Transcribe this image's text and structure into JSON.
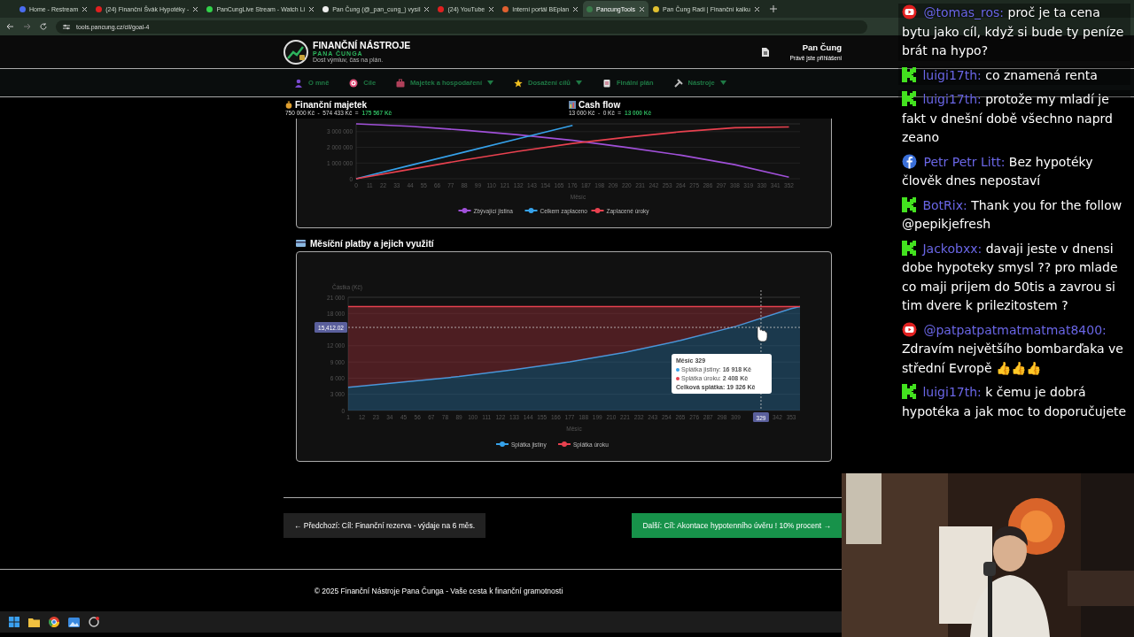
{
  "browser": {
    "tabs": [
      {
        "label": "Home - Restream",
        "selected": false
      },
      {
        "label": "(24) Finanční Švák Hypotéky -",
        "selected": false
      },
      {
        "label": "PanCungLive Stream - Watch Li",
        "selected": false
      },
      {
        "label": "Pan Čung (@_pan_cung_) vysíl",
        "selected": false
      },
      {
        "label": "(24) YouTube",
        "selected": false
      },
      {
        "label": "Interní portál BEplan",
        "selected": false
      },
      {
        "label": "PancungTools",
        "selected": true
      },
      {
        "label": "Pan Čung Radí | Finanční kalku",
        "selected": false
      }
    ],
    "address": "tools.pancung.cz/cil/goal-4"
  },
  "header": {
    "title": "FINANČNÍ NÁSTROJE",
    "subtitle": "PANA ČUNGA",
    "tagline": "Dost výmluv, čas na plán.",
    "user_name": "Pan Čung",
    "user_status": "Právě jste přihlášeni"
  },
  "nav": [
    {
      "label": "O mně",
      "has_dropdown": false
    },
    {
      "label": "Cíle",
      "has_dropdown": false
    },
    {
      "label": "Majetek a hospodaření",
      "has_dropdown": true
    },
    {
      "label": "Dosažení cílů",
      "has_dropdown": true
    },
    {
      "label": "Finální plán",
      "has_dropdown": false
    },
    {
      "label": "Nástroje",
      "has_dropdown": true
    }
  ],
  "summary": [
    {
      "title": "Finanční majetek",
      "formula": "750 000 Kč  -  574 433 Kč  =",
      "result": "175 567 Kč"
    },
    {
      "title": "Cash flow",
      "formula": "13 000 Kč  -  0 Kč  =",
      "result": "13 000 Kč"
    }
  ],
  "balance_chart": {
    "chart_data": {
      "type": "line",
      "xlabel": "Měsíc",
      "grid": true,
      "legend": "bottom",
      "x": [
        0,
        44,
        88,
        132,
        176,
        220,
        264,
        308,
        352
      ],
      "xlim": [
        0,
        361
      ],
      "ylim": [
        0,
        3500000
      ],
      "xticks": [
        0,
        11,
        22,
        33,
        44,
        55,
        66,
        77,
        88,
        99,
        110,
        121,
        132,
        143,
        154,
        165,
        176,
        187,
        198,
        209,
        220,
        231,
        242,
        253,
        264,
        275,
        286,
        297,
        308,
        319,
        330,
        341,
        352
      ],
      "yticks": [
        {
          "value": 0,
          "label": "0"
        },
        {
          "value": 1000000,
          "label": "1 000 000"
        },
        {
          "value": 2000000,
          "label": "2 000 000"
        },
        {
          "value": 3000000,
          "label": "3 000 000"
        }
      ],
      "series": [
        {
          "name": "Zbývající jistina",
          "color": "#a050d8",
          "values": [
            3500000,
            3350000,
            3100000,
            2800000,
            2450000,
            2000000,
            1500000,
            900000,
            100000
          ]
        },
        {
          "name": "Celkem zaplaceno",
          "color": "#36a2eb",
          "values": [
            0,
            850000,
            1700000,
            2550000,
            3400000,
            null,
            null,
            null,
            null
          ]
        },
        {
          "name": "Zaplacené úroky",
          "color": "#e8414f",
          "values": [
            0,
            600000,
            1200000,
            1750000,
            2250000,
            2650000,
            3000000,
            3250000,
            3300000
          ]
        }
      ]
    }
  },
  "payments_section": {
    "title": "Měsíční platby a jejich využití",
    "chart_data": {
      "type": "area",
      "stacked": true,
      "grid": true,
      "legend": "bottom",
      "ylabel": "Částka (Kč)",
      "xlabel": "Měsíc",
      "x": [
        1,
        45,
        89,
        133,
        177,
        221,
        265,
        309,
        353,
        360
      ],
      "xlim": [
        1,
        360
      ],
      "ylim": [
        0,
        21000
      ],
      "xticks": [
        1,
        12,
        23,
        34,
        45,
        56,
        67,
        78,
        89,
        100,
        111,
        122,
        133,
        144,
        155,
        166,
        177,
        188,
        199,
        210,
        221,
        232,
        243,
        254,
        265,
        276,
        287,
        298,
        309,
        342,
        353
      ],
      "yticks": [
        {
          "value": 0,
          "label": "0"
        },
        {
          "value": 3000,
          "label": "3 000"
        },
        {
          "value": 6000,
          "label": "6 000"
        },
        {
          "value": 9000,
          "label": "9 000"
        },
        {
          "value": 12000,
          "label": "12 000"
        },
        {
          "value": 18000,
          "label": "18 000"
        },
        {
          "value": 21000,
          "label": "21 000"
        }
      ],
      "series": [
        {
          "name": "Splátka jistiny",
          "color": "#36a2eb",
          "values": [
            4300,
            5300,
            6300,
            7600,
            9000,
            10800,
            13000,
            15600,
            18900,
            19300
          ]
        },
        {
          "name": "Splátka úroku",
          "color": "#e8414f",
          "values": [
            15000,
            14000,
            13000,
            11700,
            10300,
            8500,
            6300,
            3700,
            400,
            0
          ]
        }
      ],
      "ref_lines": [
        {
          "axis": "x",
          "value": 329,
          "label": "329"
        },
        {
          "axis": "y",
          "value": 15412.02,
          "label": "15,412.02"
        }
      ]
    },
    "tooltip": {
      "title": "Měsíc 329",
      "lines": [
        "Splátka jistiny: **16 918 Kč**",
        "Splátka úroku: **2 408 Kč**"
      ],
      "total": "Celková splátka: 19 326 Kč"
    }
  },
  "pager": {
    "previous": "← Předchozí: Cíl: Finanční rezerva - výdaje na 6 měs.",
    "next": "Další: Cíl: Akontace hypotenního úvěru ! 10% procent →"
  },
  "footer": "© 2025 Finanční Nástroje Pana Čunga - Vaše cesta k finanční gramotnosti",
  "chat": [
    {
      "kind": "youtube",
      "user": "@tomas_ros:",
      "text": "proč je ta cena bytu jako cíl, když si bude ty peníze brát na hypo?"
    },
    {
      "kind": "kick",
      "user": "luigi17th:",
      "text": "co znamená renta"
    },
    {
      "kind": "kick",
      "user": "luigi17th:",
      "text": "protože my mladí je fakt v dnešní době všechno naprd zeano"
    },
    {
      "kind": "facebook",
      "user": "Petr Petr Litt:",
      "text": "Bez hypotéky člověk dnes nepostaví"
    },
    {
      "kind": "kick",
      "user": "BotRix:",
      "text": "Thank you for the follow @pepikjefresh"
    },
    {
      "kind": "kick",
      "user": "Jackobxx:",
      "text": "davaji jeste v dnensi dobe hypoteky smysl ?? pro mlade co maji prijem do 50tis a zavrou si tim dvere k prilezitostem ?"
    },
    {
      "kind": "youtube",
      "user": "@patpatpatmatmatmat8400:",
      "text": "Zdravím největšího bombarďaka ve střední Evropě 👍👍👍"
    },
    {
      "kind": "kick",
      "user": "luigi17th:",
      "text": "k čemu je dobrá hypotéka a jak moc to doporučujete"
    }
  ]
}
